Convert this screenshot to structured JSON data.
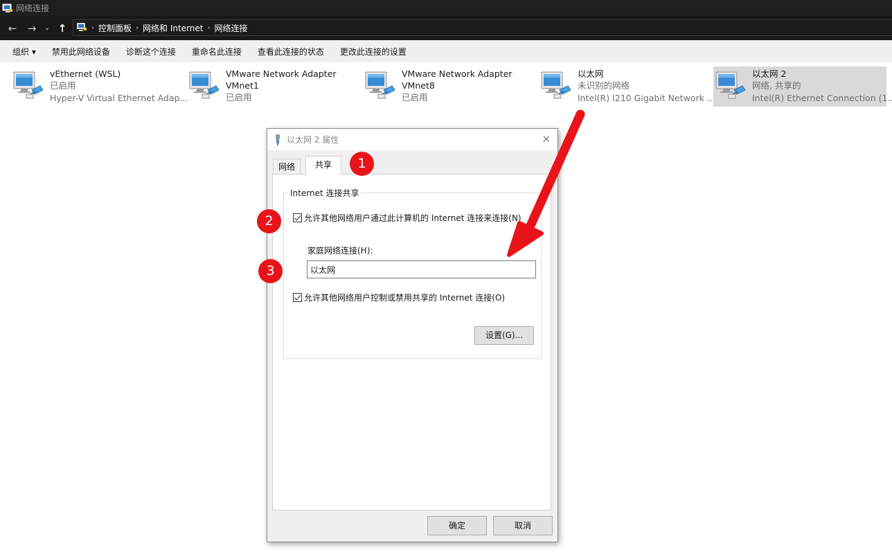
{
  "window": {
    "title": "网络连接"
  },
  "nav": {
    "back": "←",
    "forward": "→",
    "recent": "⌄",
    "up": "↑",
    "breadcrumbs": [
      "控制面板",
      "网络和 Internet",
      "网络连接"
    ],
    "separator": "›"
  },
  "commands": {
    "organize": "组织 ▾",
    "disable": "禁用此网络设备",
    "diagnose": "诊断这个连接",
    "rename": "重命名此连接",
    "status": "查看此连接的状态",
    "settings": "更改此连接的设置"
  },
  "connections": [
    {
      "name": "vEthernet (WSL)",
      "status": "已启用",
      "device": "Hyper-V Virtual Ethernet Adap..."
    },
    {
      "name": "VMware Network Adapter",
      "status": "VMnet1",
      "device": "已启用"
    },
    {
      "name": "VMware Network Adapter",
      "status": "VMnet8",
      "device": "已启用"
    },
    {
      "name": "以太网",
      "status": "未识别的网络",
      "device": "Intel(R) I210 Gigabit Network ..."
    },
    {
      "name": "以太网 2",
      "status": "网络, 共享的",
      "device": "Intel(R) Ethernet Connection (1..."
    }
  ],
  "dialog": {
    "title": "以太网 2 属性",
    "close": "✕",
    "tabs": {
      "network": "网络",
      "sharing": "共享"
    },
    "group_label": "Internet 连接共享",
    "allow_share": "允许其他网络用户通过此计算机的 Internet 连接来连接(N)",
    "allow_share_checked": true,
    "home_label": "家庭网络连接(H):",
    "home_value": "以太网",
    "allow_control": "允许其他网络用户控制或禁用共享的 Internet 连接(O)",
    "allow_control_checked": true,
    "settings_button": "设置(G)...",
    "ok_button": "确定",
    "cancel_button": "取消"
  },
  "annotations": {
    "step1": "1",
    "step2": "2",
    "step3": "3",
    "color": "#e8141a"
  }
}
